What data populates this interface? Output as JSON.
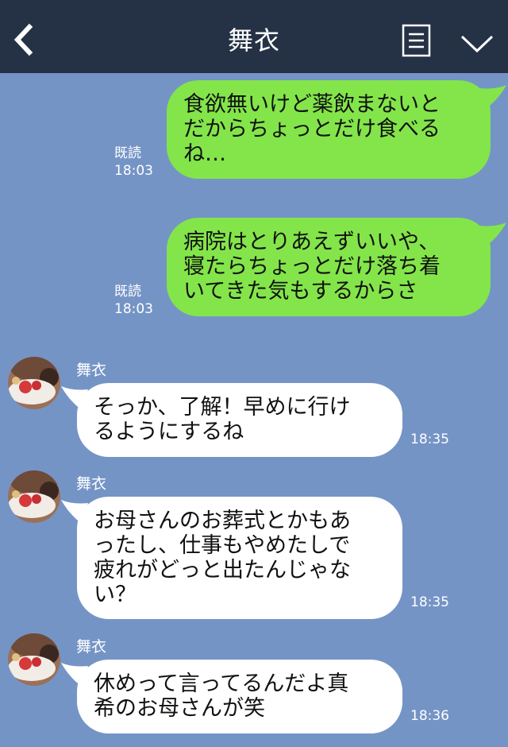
{
  "header": {
    "title": "舞衣",
    "back_icon": "chevron-left-icon",
    "menu_icon": "menu-list-icon",
    "expand_icon": "chevron-down-icon"
  },
  "colors": {
    "background": "#7594c6",
    "header_bg": "#253246",
    "outgoing_bubble": "#83e54a",
    "incoming_bubble": "#ffffff"
  },
  "messages": [
    {
      "direction": "outgoing",
      "text": "食欲無いけど薬飲まないと\nだからちょっとだけ食べる\nね…",
      "read_label": "既読",
      "time": "18:03"
    },
    {
      "direction": "outgoing",
      "text": "病院はとりあえずいいや、\n寝たらちょっとだけ落ち着\nいてきた気もするからさ",
      "read_label": "既読",
      "time": "18:03"
    },
    {
      "direction": "incoming",
      "sender": "舞衣",
      "text": "そっか、了解！早めに行け\nるようにするね",
      "time": "18:35"
    },
    {
      "direction": "incoming",
      "sender": "舞衣",
      "text": "お母さんのお葬式とかもあ\nったし、仕事もやめたしで\n疲れがどっと出たんじゃな\nい？",
      "time": "18:35"
    },
    {
      "direction": "incoming",
      "sender": "舞衣",
      "text": "休めって言ってるんだよ真\n希のお母さんが笑",
      "time": "18:36"
    }
  ]
}
